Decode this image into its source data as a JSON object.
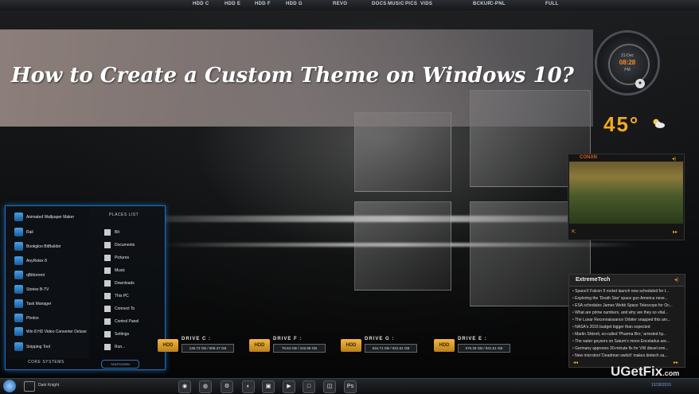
{
  "topbar": {
    "items": [
      "HDD C",
      "HDD E",
      "HDD F",
      "HDD G",
      "REVO",
      "DOCS",
      "MUSIC",
      "PICS",
      "VIDS",
      "BCKUP",
      "C-PNL",
      "FULL"
    ]
  },
  "banner": {
    "title": "How to Create a Custom Theme on Windows 10?"
  },
  "clock": {
    "day": "31-Dec",
    "time": "08:28",
    "ampm": "PM"
  },
  "weather": {
    "temperature": "45°",
    "icon": "cloud-sun-icon"
  },
  "media": {
    "title": "CONAN",
    "prev": "◂◂",
    "next": "▸▸"
  },
  "news": {
    "title": "ExtremeTech",
    "items": [
      "SpaceX Falcon 9 rocket launch now scheduled for t...",
      "Exploring the 'Death Star' space gun America neve...",
      "ESA schedules James Webb Space Telescope for Oc...",
      "What are prime numbers, and why are they so vital...",
      "The Lunar Reconnaissance Orbiter snapped this am...",
      "NASA's 2016 budget bigger than expected",
      "Martin Shkreli, so-called 'Pharma Bro,' arrested by...",
      "The water geysers on Saturn's moon Enceladus are...",
      "Germany approves 30-minute fix for VW diesel emi...",
      "New microtool 'Deadman switch' makes biotech sa..."
    ]
  },
  "start_menu": {
    "left_items": [
      "Animated Wallpaper Maker",
      "Rail",
      "Bookgloo BitBuilder",
      "AnyRetex 8",
      "qBittorrent",
      "Stories B-TV",
      "Task Manager",
      "Photos",
      "Win 8 HD Video Converter Deluxe",
      "Snipping Tool"
    ],
    "places_header": "PLACES LIST",
    "places": [
      "Bit",
      "Documents",
      "Pictures",
      "Music",
      "Downloads",
      "This PC",
      "Connect To",
      "Control Panel",
      "Settings",
      "Run..."
    ],
    "core_header": "CORE SYSTEMS",
    "shutdown_label": "SHUTDOWN"
  },
  "drives": [
    {
      "label": "DRIVE C :",
      "usage": "136.73 GB / 909.47 GB"
    },
    {
      "label": "DRIVE F :",
      "usage": "78.84 GB / 232.88 GB"
    },
    {
      "label": "DRIVE G :",
      "usage": "534.71 GB / 931.51 GB"
    },
    {
      "label": "DRIVE E :",
      "usage": "576.28 GB / 931.51 GB"
    }
  ],
  "hdd_icon_text": "HDD",
  "taskbar": {
    "user": "Dark Knight",
    "icons": [
      "chrome",
      "firefox",
      "settings",
      "steam",
      "app",
      "media",
      "app",
      "app",
      "files",
      "Ps"
    ],
    "date": "12/28/2015"
  },
  "watermark": {
    "brand": "UGetFix",
    "suffix": ".com"
  }
}
